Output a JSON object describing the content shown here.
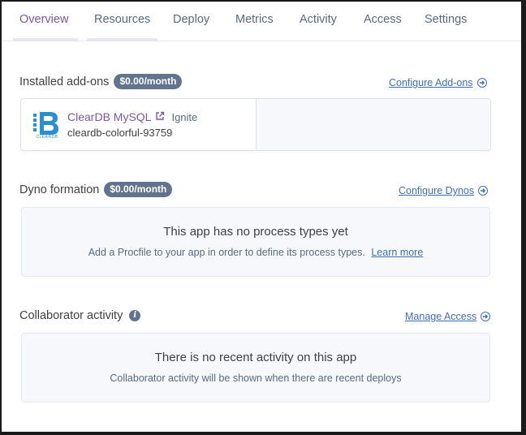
{
  "tabs": [
    {
      "label": "Overview",
      "active": true
    },
    {
      "label": "Resources",
      "active": false
    },
    {
      "label": "Deploy",
      "active": false
    },
    {
      "label": "Metrics",
      "active": false
    },
    {
      "label": "Activity",
      "active": false
    },
    {
      "label": "Access",
      "active": false
    },
    {
      "label": "Settings",
      "active": false
    }
  ],
  "addons": {
    "title": "Installed add-ons",
    "cost": "$0.00/month",
    "configure_link": "Configure Add-ons",
    "items": [
      {
        "logo_text": "CLEARDB",
        "name": "ClearDB MySQL",
        "plan": "Ignite",
        "app": "cleardb-colorful-93759",
        "icon": "external-link-icon"
      }
    ]
  },
  "dynos": {
    "title": "Dyno formation",
    "cost": "$0.00/month",
    "configure_link": "Configure Dynos",
    "empty_title": "This app has no process types yet",
    "empty_text": "Add a Procfile to your app in order to define its process types.",
    "learn_more": "Learn more"
  },
  "collaborators": {
    "title": "Collaborator activity",
    "info_glyph": "i",
    "manage_link": "Manage Access",
    "empty_title": "There is no recent activity on this app",
    "empty_text": "Collaborator activity will be shown when there are recent deploys"
  },
  "colors": {
    "accent": "#79589f",
    "link": "#3e6fb5",
    "badge": "#62738d"
  }
}
